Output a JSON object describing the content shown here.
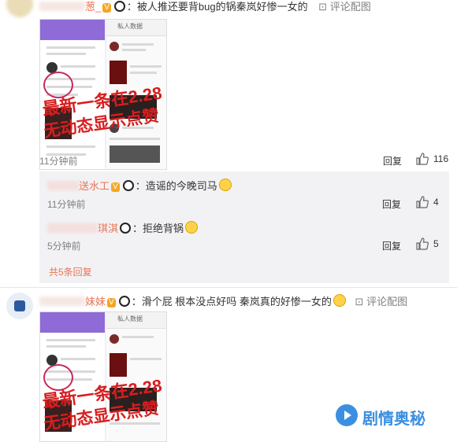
{
  "comments": [
    {
      "username": "葱_",
      "text": "：被人推还要背bug的锅秦岚好惨一女的",
      "image_label": "评论配图",
      "image_overlay_line1": "最新一条在2.28",
      "image_overlay_line2": "无动态显示点赞",
      "phone_tab_label": "私人数据",
      "time": "11分钟前",
      "reply_label": "回复",
      "likes": "116"
    },
    {
      "username": "妹妹",
      "text": "：滑个屁 根本没点好吗 秦岚真的好惨一女的",
      "image_label": "评论配图",
      "image_overlay_line1": "最新一条在2.28",
      "image_overlay_line2": "无动态显示点赞",
      "phone_tab_label": "私人数据"
    }
  ],
  "replies": [
    {
      "username": "送水工",
      "text": "：造谣的今晚司马",
      "time": "11分钟前",
      "reply_label": "回复",
      "likes": "4"
    },
    {
      "username": "琪淇",
      "text": "：拒绝背锅",
      "time": "5分钟前",
      "reply_label": "回复",
      "likes": "5"
    }
  ],
  "more_replies": "共5条回复",
  "watermark": "剧情奥秘",
  "colors": {
    "accent": "#eb7350",
    "reply_bg": "#f2f2f5",
    "phone_header": "#8e6bd6",
    "overlay_red": "#d81e1e"
  }
}
